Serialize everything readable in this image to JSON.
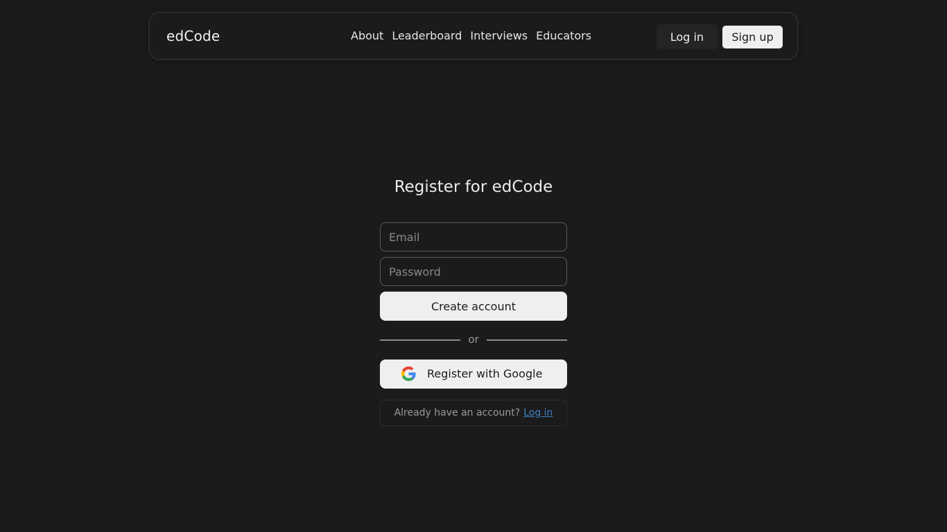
{
  "brand": "edCode",
  "nav": {
    "links": [
      "About",
      "Leaderboard",
      "Interviews",
      "Educators"
    ],
    "login_label": "Log in",
    "signup_label": "Sign up"
  },
  "form": {
    "title": "Register for edCode",
    "email_placeholder": "Email",
    "password_placeholder": "Password",
    "create_label": "Create account",
    "divider_text": "or",
    "google_label": "Register with Google",
    "google_icon": "google-g-icon",
    "login_prompt": "Already have an account?",
    "login_link": "Log in"
  },
  "colors": {
    "background": "#1b1b1b",
    "button_light": "#efefef",
    "link": "#3b82c4"
  }
}
